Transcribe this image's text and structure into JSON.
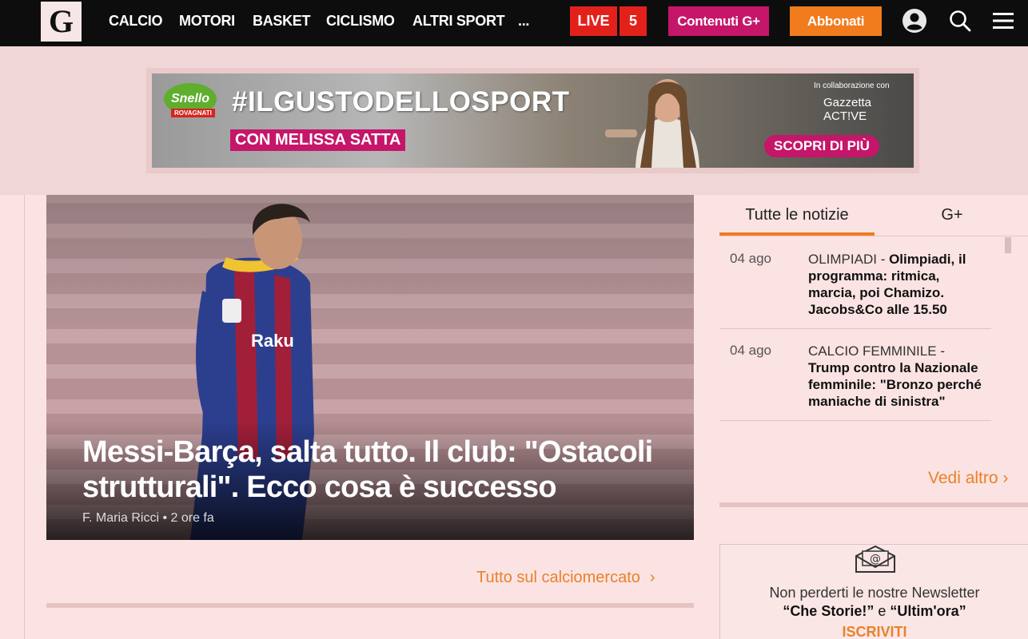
{
  "header": {
    "logo_text": "G",
    "nav": [
      "CALCIO",
      "MOTORI",
      "BASKET",
      "CICLISMO",
      "ALTRI SPORT",
      "..."
    ],
    "live_label": "LIVE",
    "live_count": "5",
    "gplus_label": "Contenuti G+",
    "subscribe_label": "Abbonati",
    "icons": [
      "user-icon",
      "search-icon",
      "menu-icon"
    ]
  },
  "ad": {
    "brand": "Snello",
    "sub_brand": "ROVAGNATI",
    "hashtag": "#ILGUSTODELLOSPORT",
    "with": "CON MELISSA SATTA",
    "collab_line1": "In collaborazione con",
    "collab_line2": "Gazzetta ACT!VE",
    "cta": "SCOPRI DI PIÙ"
  },
  "hero": {
    "title": "Messi-Barça, salta tutto. Il club: \"Ostacoli strutturali\". Ecco cosa è successo",
    "author": "F. Maria Ricci",
    "time": "2 ore fa",
    "more_link": "Tutto sul calciomercato"
  },
  "sidebar": {
    "tabs": [
      "Tutte le notizie",
      "G+"
    ],
    "news": [
      {
        "date": "04 ago",
        "category": "OLIMPIADI",
        "headline": "Olimpiadi, il programma: ritmica, marcia, poi Chamizo. Jacobs&Co alle 15.50"
      },
      {
        "date": "04 ago",
        "category": "CALCIO FEMMINILE",
        "headline": "Trump contro la Nazionale femminile: \"Bronzo perché maniache di sinistra\""
      }
    ],
    "see_more": "Vedi altro"
  },
  "newsletter": {
    "line1": "Non perderti le nostre Newsletter",
    "name1": "“Che Storie!”",
    "conj": "e",
    "name2": "“Ultim'ora”",
    "cta": "ISCRIVITI"
  },
  "colors": {
    "live": "#e3211b",
    "gplus": "#c5166a",
    "subscribe": "#f07c1e",
    "link": "#e8822a",
    "background": "#fbe3e3"
  }
}
